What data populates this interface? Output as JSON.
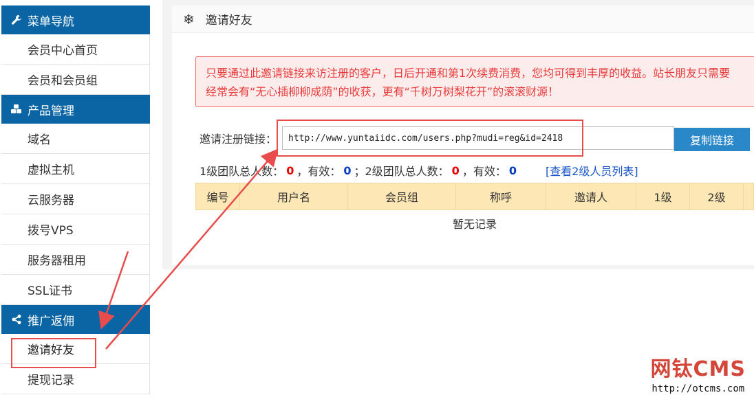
{
  "sidebar": {
    "sections": [
      {
        "title": "菜单导航",
        "icon": "wrench-icon",
        "items": [
          "会员中心首页",
          "会员和会员组"
        ]
      },
      {
        "title": "产品管理",
        "icon": "cubes-icon",
        "items": [
          "域名",
          "虚拟主机",
          "云服务器",
          "拨号VPS",
          "服务器租用",
          "SSL证书"
        ]
      },
      {
        "title": "推广返佣",
        "icon": "share-icon",
        "items": [
          "邀请好友",
          "提现记录"
        ]
      }
    ]
  },
  "panel": {
    "title": "邀请好友",
    "notice_line1": "只要通过此邀请链接来访注册的客户，日后开通和第1次续费消费，您均可得到丰厚的收益。站长朋友只需要",
    "notice_line2": "经常会有“无心插柳柳成荫”的收获，更有“千树万树梨花开”的滚滚财源！",
    "link_label": "邀请注册链接：",
    "link_value": "http://www.yuntaiidc.com/users.php?mudi=reg&id=2418",
    "copy_button": "复制链接",
    "stats": {
      "level1_label": "1级团队总人数：",
      "level1_total": "0",
      "level1_valid_label": "，有效：",
      "level1_valid": "0",
      "level2_label": "；2级团队总人数：",
      "level2_total": "0",
      "level2_valid_label": "，有效：",
      "level2_valid": "0",
      "level2_link": "[查看2级人员列表]"
    },
    "table": {
      "headers": [
        "编号",
        "用户名",
        "会员组",
        "称呼",
        "邀请人",
        "1级",
        "2级",
        ""
      ],
      "empty_text": "暂无记录"
    }
  },
  "watermark": {
    "brand": "网钛CMS",
    "url": "http://otcms.com"
  },
  "colors": {
    "sidebar_header": "#0b64a3",
    "notice_text": "#e83a3a",
    "copy_button": "#2a87c8",
    "table_header": "#fde7b4",
    "annotation": "#e84c4c"
  }
}
